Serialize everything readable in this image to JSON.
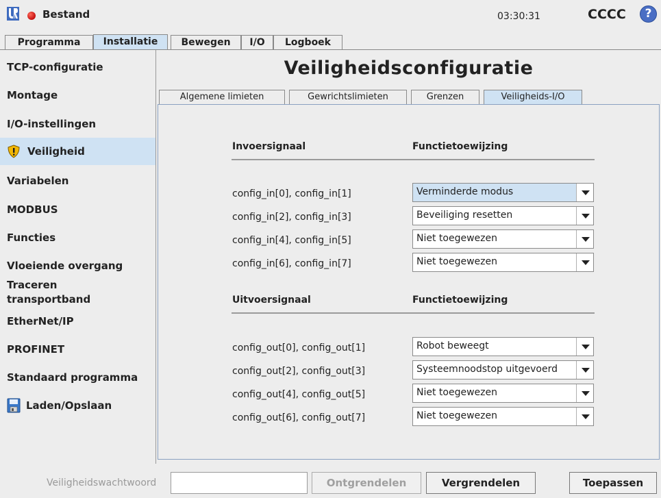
{
  "header": {
    "file_label": "Bestand",
    "clock": "03:30:31",
    "robot_name": "CCCC",
    "help_glyph": "?"
  },
  "tabs": [
    {
      "label": "Programma"
    },
    {
      "label": "Installatie"
    },
    {
      "label": "Bewegen"
    },
    {
      "label": "I/O"
    },
    {
      "label": "Logboek"
    }
  ],
  "sidebar": {
    "items": [
      {
        "label": "TCP-configuratie"
      },
      {
        "label": "Montage"
      },
      {
        "label": "I/O-instellingen"
      },
      {
        "label": "Veiligheid"
      },
      {
        "label": "Variabelen"
      },
      {
        "label": "MODBUS"
      },
      {
        "label": "Functies"
      },
      {
        "label": "Vloeiende overgang"
      },
      {
        "label": "Traceren transportband"
      },
      {
        "label": "EtherNet/IP"
      },
      {
        "label": "PROFINET"
      },
      {
        "label": "Standaard programma"
      },
      {
        "label": "Laden/Opslaan"
      }
    ]
  },
  "main": {
    "title": "Veiligheidsconfiguratie",
    "subtabs": [
      {
        "label": "Algemene limieten"
      },
      {
        "label": "Gewrichtslimieten"
      },
      {
        "label": "Grenzen"
      },
      {
        "label": "Veiligheids-I/O"
      }
    ],
    "inputs": {
      "signal_header": "Invoersignaal",
      "function_header": "Functietoewijzing",
      "rows": [
        {
          "signal": "config_in[0], config_in[1]",
          "function": "Verminderde modus"
        },
        {
          "signal": "config_in[2], config_in[3]",
          "function": "Beveiliging resetten"
        },
        {
          "signal": "config_in[4], config_in[5]",
          "function": "Niet toegewezen"
        },
        {
          "signal": "config_in[6], config_in[7]",
          "function": "Niet toegewezen"
        }
      ]
    },
    "outputs": {
      "signal_header": "Uitvoersignaal",
      "function_header": "Functietoewijzing",
      "rows": [
        {
          "signal": "config_out[0], config_out[1]",
          "function": "Robot beweegt"
        },
        {
          "signal": "config_out[2], config_out[3]",
          "function": "Systeemnoodstop uitgevoerd"
        },
        {
          "signal": "config_out[4], config_out[5]",
          "function": "Niet toegewezen"
        },
        {
          "signal": "config_out[6], config_out[7]",
          "function": "Niet toegewezen"
        }
      ]
    }
  },
  "footer": {
    "password_label": "Veiligheidswachtwoord",
    "password_value": "",
    "unlock_label": "Ontgrendelen",
    "lock_label": "Vergrendelen",
    "apply_label": "Toepassen"
  },
  "colors": {
    "selected": "#cfe2f3",
    "status_dot": "#d0201a",
    "help": "#4a6ec4",
    "warning": "#f2b705"
  }
}
